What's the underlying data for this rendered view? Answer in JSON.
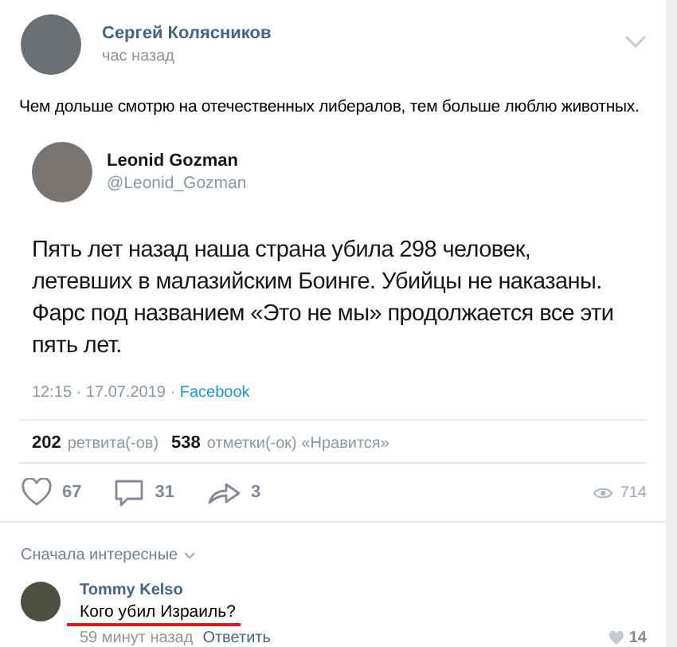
{
  "post": {
    "author": "Сергей Колясников",
    "time": "час назад",
    "text": "Чем дольше смотрю на отечественных либералов, тем больше люблю животных."
  },
  "tweet": {
    "name": "Leonid Gozman",
    "handle": "@Leonid_Gozman",
    "text": "Пять лет назад наша страна убила 298 человек, летевших в малазийским Боинге. Убийцы не наказаны. Фарс под названием «Это не мы» продолжается все эти пять лет.",
    "date": "12:15 · 17.07.2019 · ",
    "source": "Facebook",
    "retweets_count": "202",
    "retweets_label": "ретвита(-ов)",
    "likes_count": "538",
    "likes_label": "отметки(-ок) «Нравится»"
  },
  "actions": {
    "likes": "67",
    "comments": "31",
    "shares": "3",
    "views": "714"
  },
  "comments_sort": "Сначала интересные",
  "comments": [
    {
      "author": "Tommy Kelso",
      "text": "Кого убил Израиль?",
      "time": "59 минут назад",
      "reply": "Ответить",
      "likes": "14"
    }
  ]
}
